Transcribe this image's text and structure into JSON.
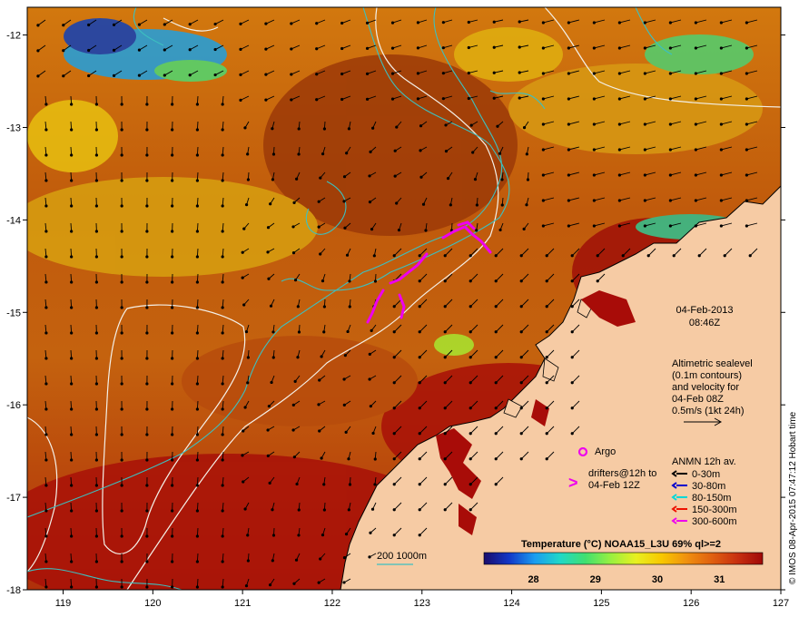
{
  "map": {
    "lon_range": [
      118.6,
      127.0
    ],
    "lat_range": [
      -18.0,
      -11.7
    ],
    "lon_ticks": [
      "119",
      "120",
      "121",
      "122",
      "123",
      "124",
      "125",
      "126",
      "127"
    ],
    "lat_ticks": [
      "-12",
      "-13",
      "-14",
      "-15",
      "-16",
      "-17",
      "-18"
    ]
  },
  "annotations": {
    "date": "04-Feb-2013",
    "time": "08:46Z",
    "altimetry": [
      "Altimetric sealevel",
      "(0.1m contours)",
      "and velocity for",
      "04-Feb 08Z",
      "0.5m/s (1kt 24h)"
    ],
    "argo_label": "Argo",
    "drifters_line1": "drifters@12h to",
    "drifters_line2": "04-Feb 12Z",
    "drifters_symbol": ">",
    "isobath_label": "200  1000m"
  },
  "legend": {
    "title": "ANMN 12h av.",
    "items": [
      {
        "label": "0-30m",
        "color": "#000000"
      },
      {
        "label": "30-80m",
        "color": "#0000cc"
      },
      {
        "label": "80-150m",
        "color": "#00d8d8"
      },
      {
        "label": "150-300m",
        "color": "#ee1100"
      },
      {
        "label": "300-600m",
        "color": "#ee00ee"
      }
    ]
  },
  "colorbar": {
    "title": "Temperature (°C) NOAA15_L3U 69% ql>=2",
    "range": [
      27.2,
      31.7
    ],
    "ticks": [
      "28",
      "29",
      "30",
      "31"
    ],
    "colors": [
      "#1a0c6b",
      "#1238c8",
      "#1a9cf0",
      "#20d8c8",
      "#40e070",
      "#98f040",
      "#e8f020",
      "#f8c800",
      "#f09010",
      "#e06010",
      "#c83010",
      "#a00808"
    ]
  },
  "credit": "© IMOS 08-Apr-2015 07:47:12 Hobart time",
  "colors": {
    "land": "#f6cba4",
    "isobath": "#3cc0c0",
    "sealevel_contour": "#f4f0e8",
    "drifter": "#ee00ee"
  }
}
